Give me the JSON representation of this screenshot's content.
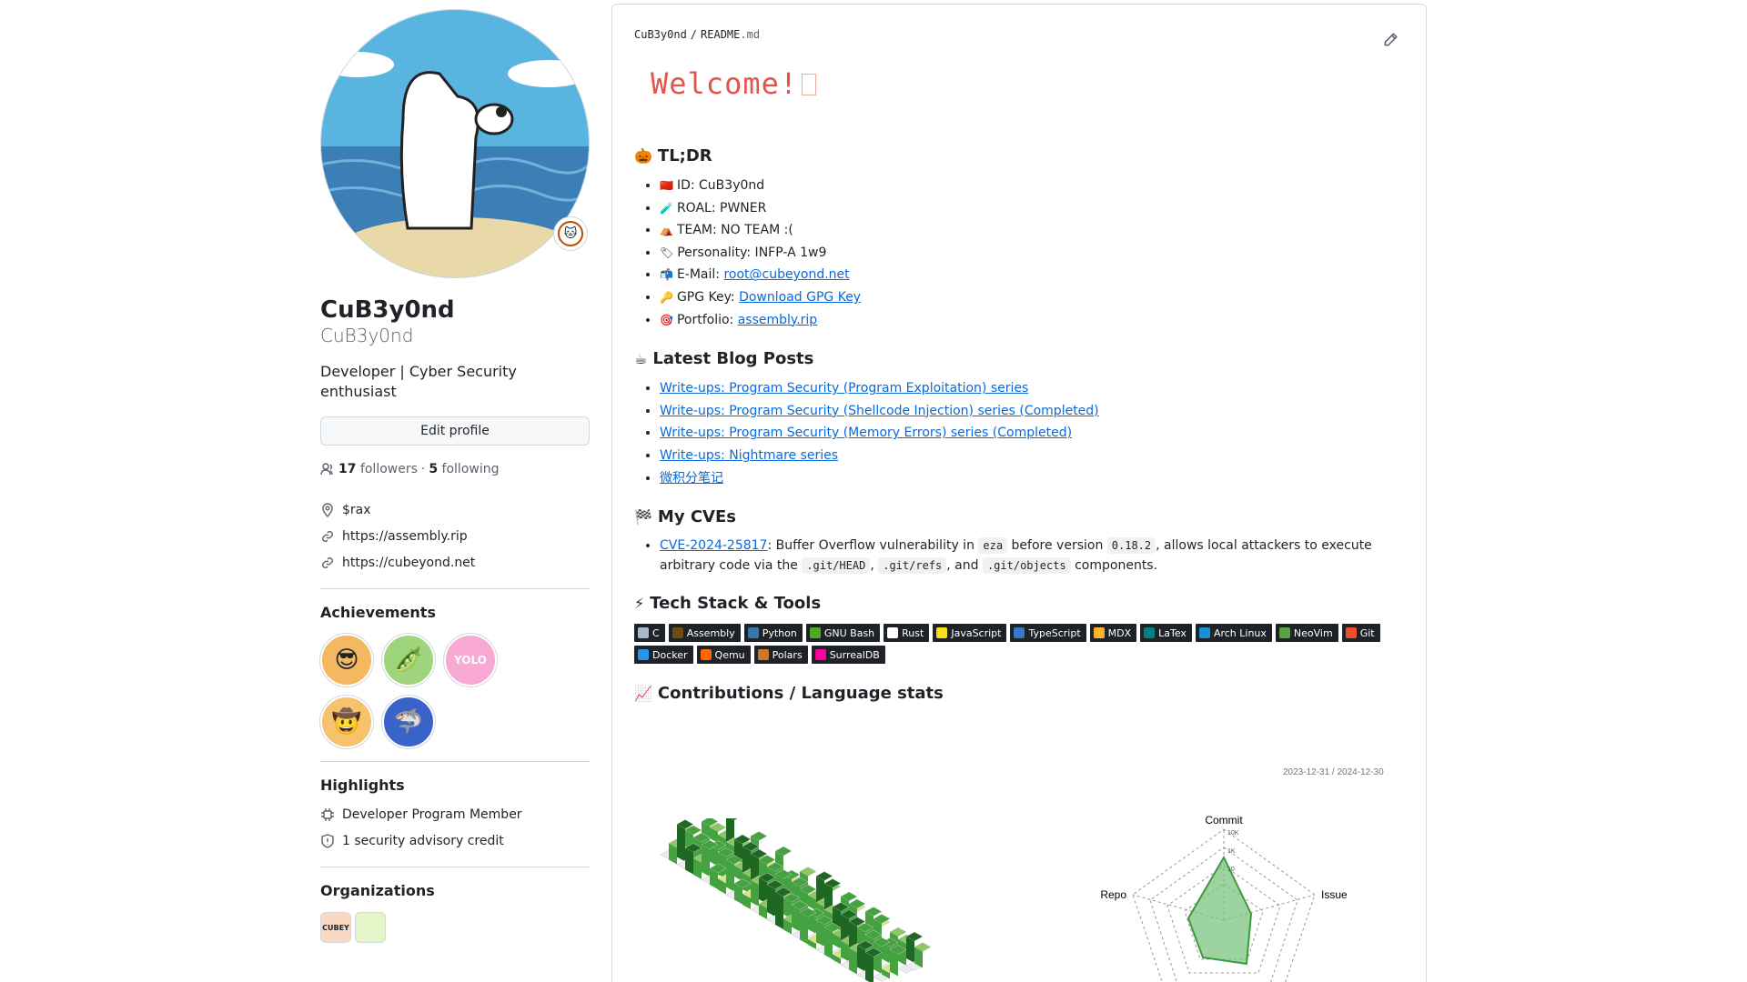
{
  "profile": {
    "fullname": "CuB3y0nd",
    "username": "CuB3y0nd",
    "bio": "Developer | Cyber Security enthusiast",
    "edit_profile": "Edit profile",
    "followers_count": "17",
    "followers_label": "followers",
    "following_count": "5",
    "following_label": "following",
    "location": "$rax",
    "links": [
      "https://assembly.rip",
      "https://cubeyond.net"
    ]
  },
  "achievements": {
    "title": "Achievements",
    "items": [
      {
        "icon": "😎",
        "color": "#f4b860"
      },
      {
        "icon": "🫛",
        "color": "#9ed47c"
      },
      {
        "icon": "YOLO",
        "color": "#f7a9d4"
      },
      {
        "icon": "🤠",
        "color": "#f6c26b"
      },
      {
        "icon": "🦈",
        "color": "#3a63c9"
      }
    ]
  },
  "highlights": {
    "title": "Highlights",
    "items": [
      "Developer Program Member",
      "1 security advisory credit"
    ]
  },
  "organizations": {
    "title": "Organizations",
    "items": [
      {
        "label": "CUBEY",
        "color": "#f7d9c4"
      },
      {
        "label": "",
        "color": "#e4f5c8"
      }
    ]
  },
  "readme": {
    "owner": "CuB3y0nd",
    "sep": "/",
    "file": "README",
    "ext": ".md",
    "welcome": "Welcome!",
    "tldr": {
      "title": "TL;DR",
      "icon": "🎃",
      "items": [
        {
          "emo": "🇨🇳",
          "label": "ID: CuB3y0nd",
          "link": ""
        },
        {
          "emo": "🧪",
          "label": "ROAL: PWNER",
          "link": ""
        },
        {
          "emo": "⛺",
          "label": "TEAM: NO TEAM :(",
          "link": ""
        },
        {
          "emo": "🏷",
          "label": "Personality: INFP-A 1w9",
          "link": ""
        },
        {
          "emo": "📬",
          "label": "E-Mail: ",
          "link": "root@cubeyond.net"
        },
        {
          "emo": "🔑",
          "label": "GPG Key: ",
          "link": "Download GPG Key"
        },
        {
          "emo": "🎯",
          "label": "Portfolio: ",
          "link": "assembly.rip"
        }
      ]
    },
    "blog": {
      "title": "Latest Blog Posts",
      "icon": "☕",
      "items": [
        "Write-ups: Program Security (Program Exploitation) series",
        "Write-ups: Program Security (Shellcode Injection) series (Completed)",
        "Write-ups: Program Security (Memory Errors) series (Completed)",
        "Write-ups: Nightmare series",
        "微积分笔记"
      ]
    },
    "cves": {
      "title": "My CVEs",
      "icon": "🏁",
      "cve_id": "CVE-2024-25817",
      "t1": ": Buffer Overflow vulnerability in ",
      "c1": "eza",
      "t2": " before version ",
      "c2": "0.18.2",
      "t3": ", allows local attackers to execute arbitrary code via the ",
      "c3": ".git/HEAD",
      "t4": ", ",
      "c4": ".git/refs",
      "t5": ", and ",
      "c5": ".git/objects",
      "t6": " components."
    },
    "tech": {
      "title": "Tech Stack & Tools",
      "icon": "⚡",
      "badges": [
        {
          "label": "C",
          "color": "#a8b9cc"
        },
        {
          "label": "Assembly",
          "color": "#6e4c13"
        },
        {
          "label": "Python",
          "color": "#3776ab"
        },
        {
          "label": "GNU Bash",
          "color": "#4eaa25"
        },
        {
          "label": "Rust",
          "color": "#ffffff"
        },
        {
          "label": "JavaScript",
          "color": "#f7df1e"
        },
        {
          "label": "TypeScript",
          "color": "#3178c6"
        },
        {
          "label": "MDX",
          "color": "#fcb32c"
        },
        {
          "label": "LaTex",
          "color": "#008080"
        },
        {
          "label": "Arch Linux",
          "color": "#1793d1"
        },
        {
          "label": "NeoVim",
          "color": "#57a143"
        },
        {
          "label": "Git",
          "color": "#f05032"
        },
        {
          "label": "Docker",
          "color": "#2496ed"
        },
        {
          "label": "Qemu",
          "color": "#ff6600"
        },
        {
          "label": "Polars",
          "color": "#cd792c"
        },
        {
          "label": "SurrealDB",
          "color": "#ff00a0"
        }
      ]
    },
    "stats": {
      "title": "Contributions / Language stats",
      "icon": "📈",
      "range": "2023-12-31 / 2024-12-30",
      "radar_labels": {
        "top": "Commit",
        "left": "Repo",
        "right": "Issue"
      },
      "radar_ticks": [
        "10K",
        "1K",
        "10"
      ]
    }
  }
}
